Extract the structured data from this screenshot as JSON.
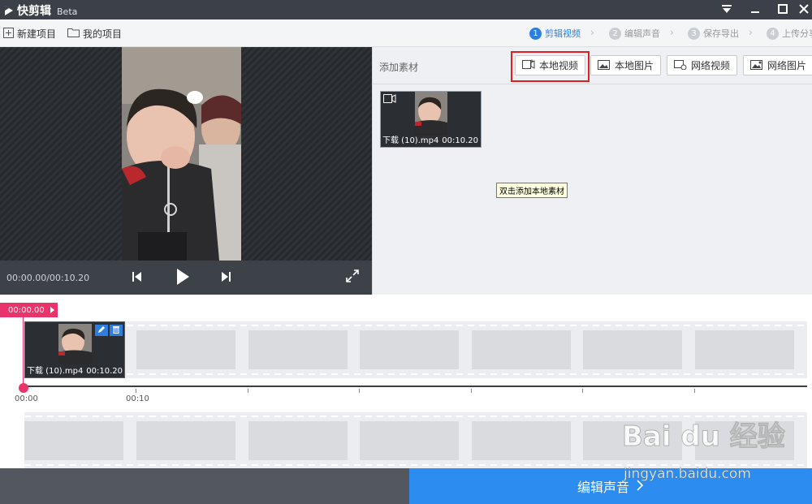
{
  "app": {
    "name": "快剪辑",
    "badge": "Beta"
  },
  "window_controls": {
    "menu": "menu-icon",
    "minimize": "minimize-icon",
    "maximize": "maximize-icon",
    "close": "close-icon"
  },
  "toolbar": {
    "new_project": "新建项目",
    "my_projects": "我的项目",
    "steps": [
      {
        "num": "1",
        "label": "剪辑视频",
        "active": true
      },
      {
        "num": "2",
        "label": "编辑声音",
        "active": false
      },
      {
        "num": "3",
        "label": "保存导出",
        "active": false
      },
      {
        "num": "4",
        "label": "上传分享",
        "active": false
      }
    ]
  },
  "player": {
    "time": "00:00.00/00:10.20"
  },
  "material": {
    "title": "添加素材",
    "buttons": {
      "local_video": "本地视频",
      "local_image": "本地图片",
      "web_video": "网络视频",
      "web_image": "网络图片"
    },
    "items": [
      {
        "name": "下载 (10).mp4",
        "duration": "00:10.20"
      }
    ],
    "tooltip": "双击添加本地素材"
  },
  "timeline": {
    "current_time": "00:00.00",
    "clip": {
      "name": "下载 (10).mp4",
      "duration": "00:10.20"
    },
    "ruler_labels": [
      "00:00",
      "00:10"
    ]
  },
  "bottom": {
    "next_label": "编辑声音"
  },
  "watermark": {
    "logo": "Bai du 经验",
    "url": "jingyan.baidu.com"
  },
  "colors": {
    "accent": "#2d8cf0",
    "playhead": "#e8336b",
    "highlight": "#e02020"
  }
}
